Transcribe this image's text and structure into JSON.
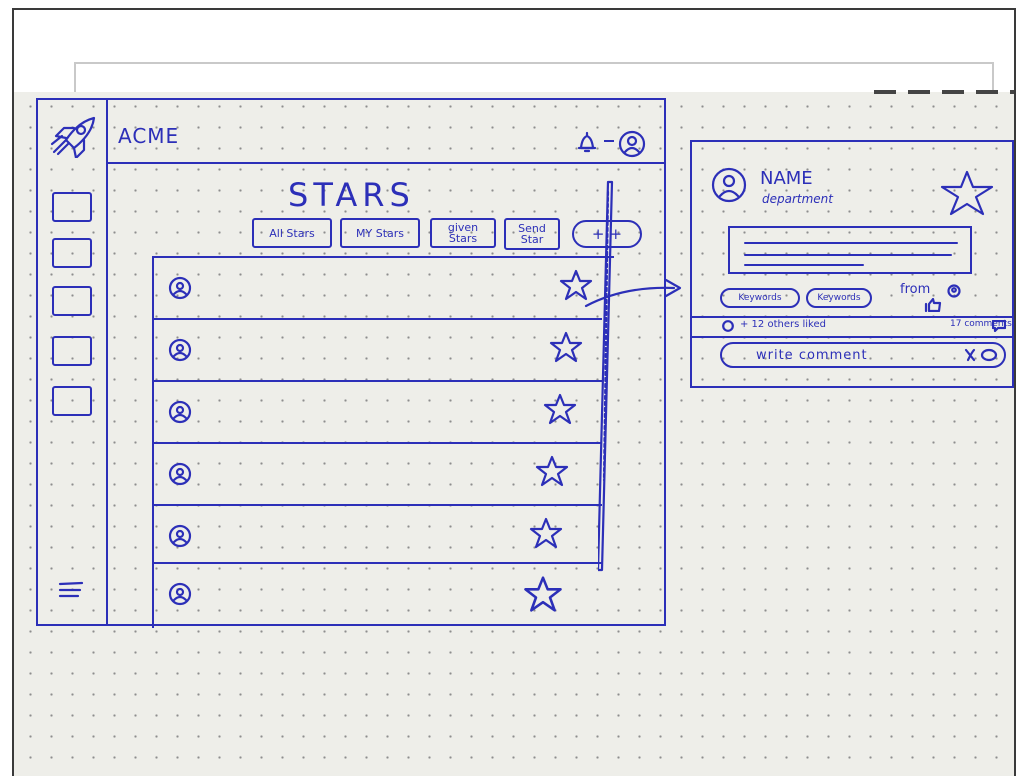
{
  "app": {
    "brand": "ACME",
    "page_title": "STARS",
    "colors": {
      "ink": "#2c2fb8",
      "paper": "#eeeee9",
      "frame": "#3a3a3a"
    }
  },
  "tabs": [
    {
      "label": "All Stars"
    },
    {
      "label": "MY Stars"
    },
    {
      "label": "given Stars"
    },
    {
      "label": "Send Star"
    }
  ],
  "filter": {
    "label": "+|+"
  },
  "icons": {
    "logo": "rocket-icon",
    "notification": "bell-icon",
    "profile": "avatar-icon",
    "menu": "hamburger-icon",
    "row_action": "star-icon"
  },
  "sidebar": {
    "item_count": 5
  },
  "list": {
    "row_count": 6
  },
  "detail_card": {
    "name": "NAME",
    "department": "department",
    "keywords": [
      "Keywords",
      "Keywords"
    ],
    "from_label": "from",
    "likes_text": "+ 12 others liked",
    "comments_text": "17 comments",
    "comment_placeholder": "write comment"
  }
}
